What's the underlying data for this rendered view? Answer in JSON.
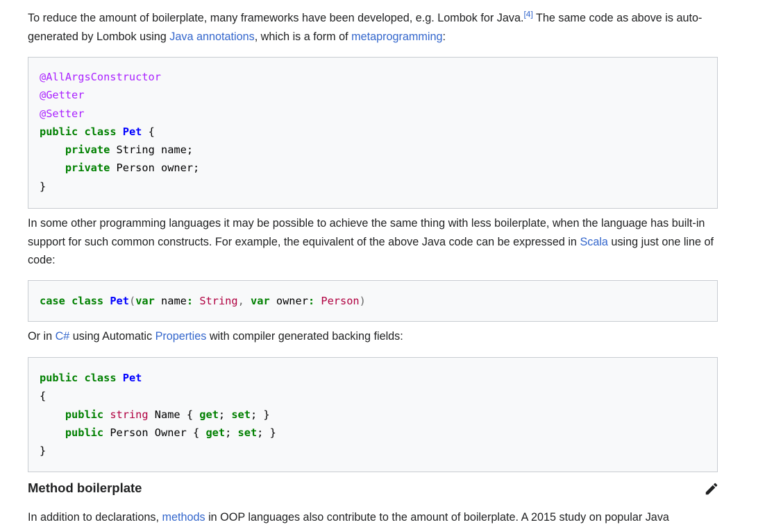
{
  "p1": {
    "t1": "To reduce the amount of boilerplate, many frameworks have been developed, e.g. Lombok for Java.",
    "ref": "[4]",
    "t2": " The same code as above is auto-generated by Lombok using ",
    "link1": "Java annotations",
    "t3": ", which is a form of ",
    "link2": "metaprogramming",
    "t4": ":"
  },
  "code1": {
    "line1": "@AllArgsConstructor",
    "line2": "@Getter",
    "line3": "@Setter",
    "kw_public": "public",
    "kw_class": "class",
    "class_name": "Pet",
    "brace_open": " {",
    "kw_private1": "private",
    "field1": " String name;",
    "kw_private2": "private",
    "field2": " Person owner;",
    "brace_close": "}"
  },
  "p2": {
    "t1": "In some other programming languages it may be possible to achieve the same thing with less boilerplate, when the language has built-in support for such common constructs. For example, the equivalent of the above Java code can be expressed in ",
    "link1": "Scala",
    "t2": " using just one line of code:"
  },
  "code2": {
    "kw_case": "case",
    "kw_class": "class",
    "class_name": "Pet",
    "paren_open": "(",
    "kw_var1": "var",
    "name_field": " name",
    "colon1": ":",
    "type1": " String",
    "comma": ",",
    "kw_var2": "var",
    "owner_field": " owner",
    "colon2": ":",
    "type2": " Person",
    "paren_close": ")"
  },
  "p3": {
    "t1": "Or in ",
    "link1": "C#",
    "t2": " using Automatic ",
    "link2": "Properties",
    "t3": " with compiler generated backing fields:"
  },
  "code3": {
    "kw_public": "public",
    "kw_class": "class",
    "class_name": "Pet",
    "brace_open": "{",
    "kw_public1": "public",
    "type_string": "string",
    "name_prop": " Name { ",
    "kw_get1": "get",
    "semi1": "; ",
    "kw_set1": "set",
    "end1": "; }",
    "kw_public2": "public",
    "owner_prop": " Person Owner { ",
    "kw_get2": "get",
    "semi2": "; ",
    "kw_set2": "set",
    "end2": "; }",
    "brace_close": "}"
  },
  "heading": {
    "title": "Method boilerplate"
  },
  "p4": {
    "t1": "In addition to declarations, ",
    "link1": "methods",
    "t2": " in OOP languages also contribute to the amount of boilerplate. A 2015 study on popular Java"
  },
  "icons": {
    "edit": "pencil-icon"
  },
  "colors": {
    "link": "#3366cc",
    "text": "#202122",
    "annotation": "#aa22ff",
    "keyword": "#008000",
    "class_name": "#0000ff",
    "type": "#b00040",
    "code_bg": "#f8f9fa",
    "code_border": "#c8ccd1"
  }
}
